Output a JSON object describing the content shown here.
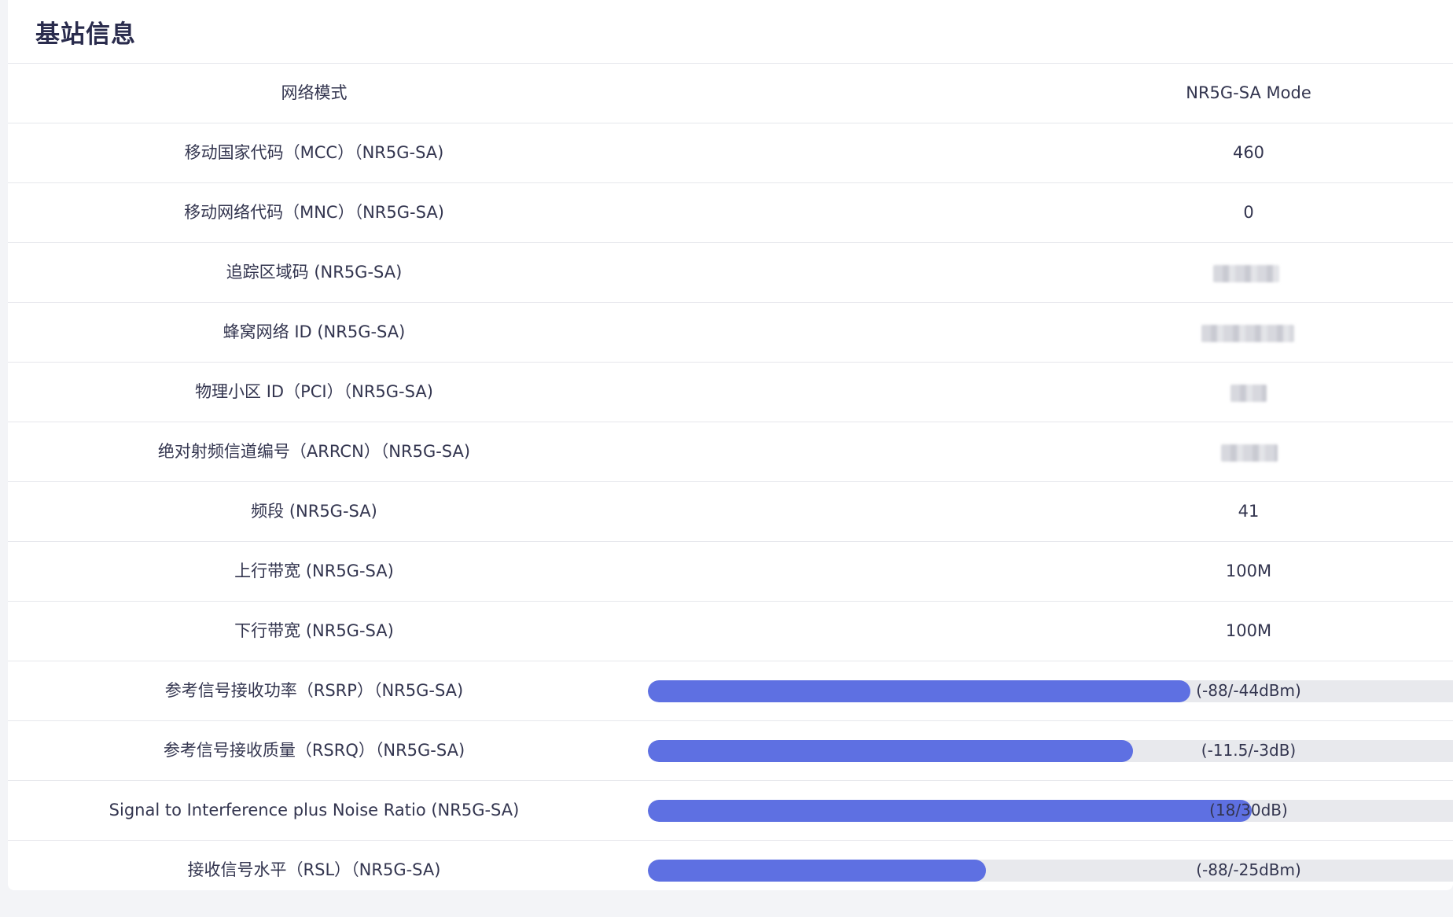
{
  "card": {
    "title": "基站信息"
  },
  "rows": [
    {
      "label": "网络模式",
      "value": "NR5G-SA Mode"
    },
    {
      "label": "移动国家代码（MCC）（NR5G-SA)",
      "value": "460"
    },
    {
      "label": "移动网络代码（MNC）（NR5G-SA)",
      "value": "0"
    },
    {
      "label": "追踪区域码 (NR5G-SA)",
      "value": "",
      "redacted": true
    },
    {
      "label": "蜂窝网络 ID (NR5G-SA)",
      "value": "",
      "redacted": true
    },
    {
      "label": "物理小区 ID（PCI）（NR5G-SA)",
      "value": "",
      "redacted": true
    },
    {
      "label": "绝对射频信道编号（ARRCN）（NR5G-SA)",
      "value": "",
      "redacted": true
    },
    {
      "label": "频段 (NR5G-SA)",
      "value": "41"
    },
    {
      "label": "上行带宽 (NR5G-SA)",
      "value": "100M"
    },
    {
      "label": "下行带宽 (NR5G-SA)",
      "value": "100M"
    }
  ],
  "signals": [
    {
      "label": "参考信号接收功率（RSRP）（NR5G-SA)",
      "value_text": "(-88/-44dBm)",
      "fill_fraction": 0.674
    },
    {
      "label": "参考信号接收质量（RSRQ）（NR5G-SA)",
      "value_text": "(-11.5/-3dB)",
      "fill_fraction": 0.603
    },
    {
      "label": "Signal to Interference plus Noise Ratio (NR5G-SA)",
      "value_text": "(18/30dB)",
      "fill_fraction": 0.75
    },
    {
      "label": "接收信号水平（RSL）（NR5G-SA)",
      "value_text": "(-88/-25dBm)",
      "fill_fraction": 0.42
    }
  ],
  "colors": {
    "accent": "#5e70e2",
    "track": "#e8e9ed",
    "text": "#33354f",
    "title": "#2a2c4d",
    "background": "#f3f4f7"
  }
}
